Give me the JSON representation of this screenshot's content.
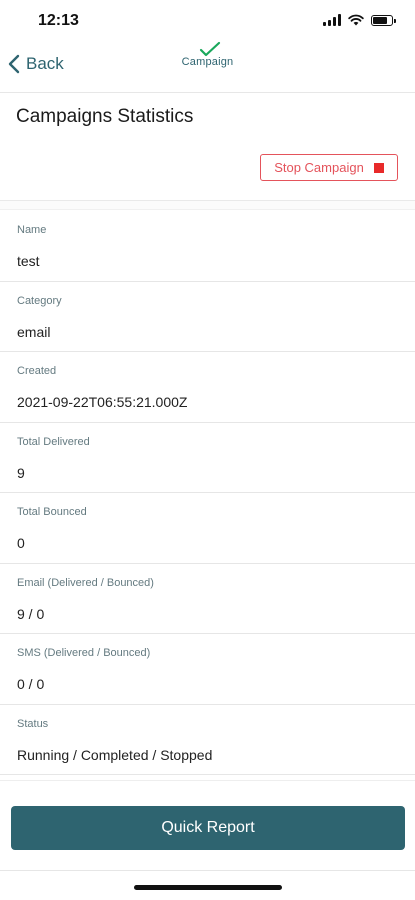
{
  "status_bar": {
    "time": "12:13",
    "battery_level": 0.85
  },
  "nav": {
    "back_label": "Back",
    "logo_text": "Campaign"
  },
  "page": {
    "title": "Campaigns Statistics"
  },
  "actions": {
    "stop_label": "Stop Campaign",
    "quick_report_label": "Quick Report"
  },
  "fields": [
    {
      "label": "Name",
      "value": "test"
    },
    {
      "label": "Category",
      "value": "email"
    },
    {
      "label": "Created",
      "value": "2021-09-22T06:55:21.000Z"
    },
    {
      "label": "Total Delivered",
      "value": "9"
    },
    {
      "label": "Total Bounced",
      "value": "0"
    },
    {
      "label": "Email (Delivered / Bounced)",
      "value": "9 / 0"
    },
    {
      "label": "SMS (Delivered / Bounced)",
      "value": "0 / 0"
    },
    {
      "label": "Status",
      "value": "Running / Completed / Stopped"
    }
  ],
  "colors": {
    "accent": "#2e6470",
    "danger": "#e4535b",
    "logo_check": "#1aa85c"
  }
}
